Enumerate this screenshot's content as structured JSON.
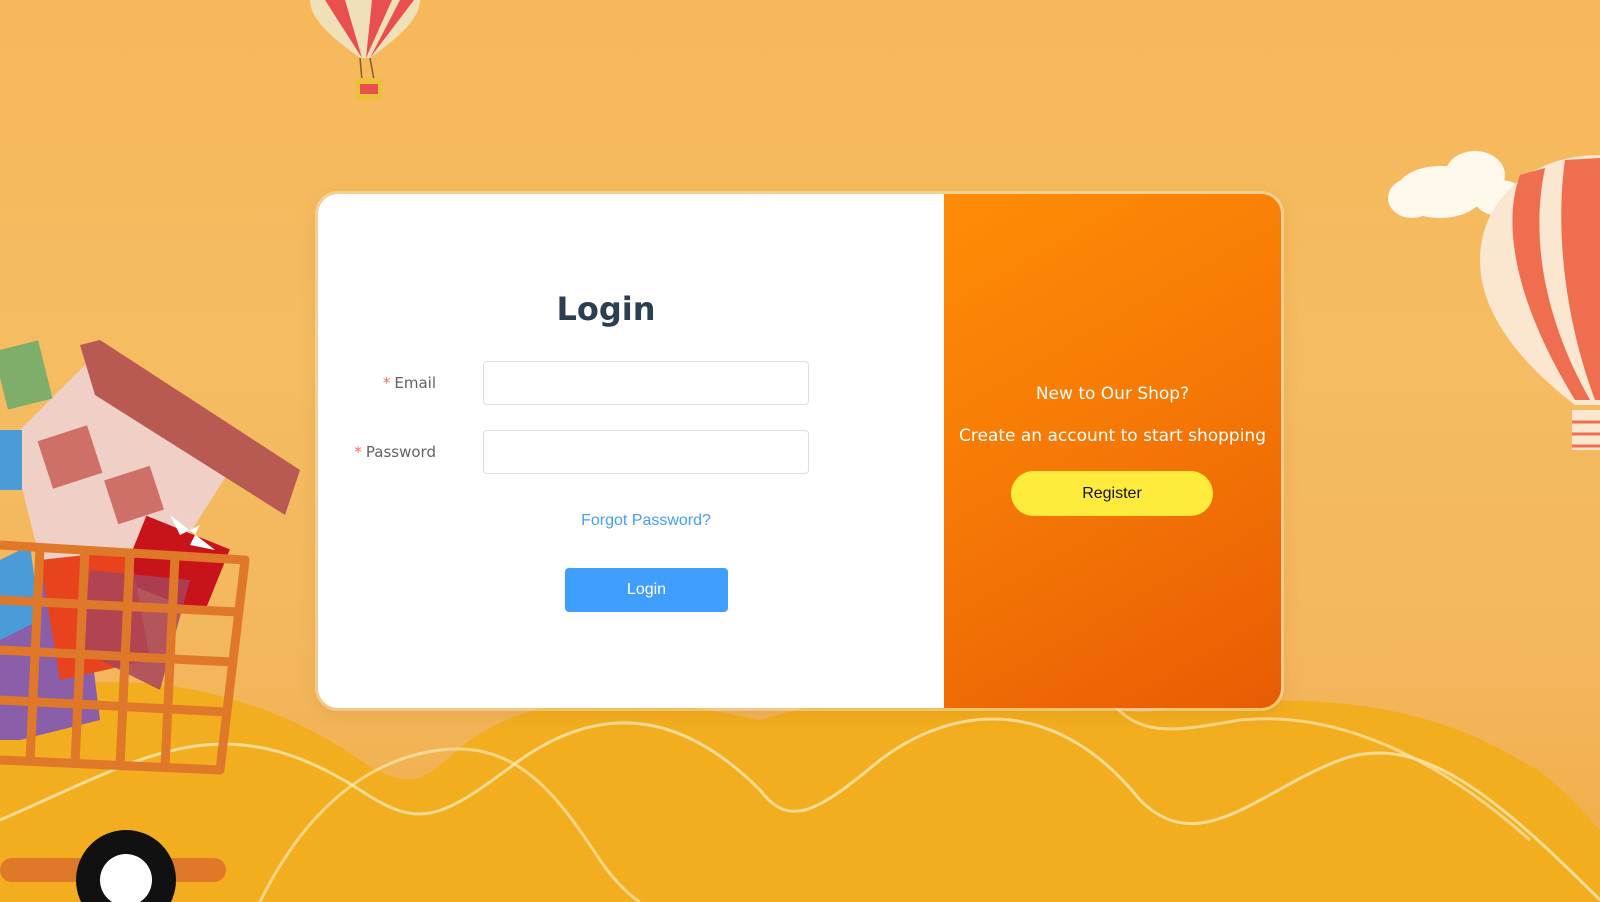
{
  "colors": {
    "accent": "#409eff",
    "promo_start": "#ff8c05",
    "promo_end": "#e85c04",
    "register_bg": "#ffeb3b",
    "required": "#f56c6c",
    "title": "#2c3e50"
  },
  "login_form": {
    "title": "Login",
    "email": {
      "required_mark": "*",
      "label": "Email",
      "value": "",
      "placeholder": ""
    },
    "password": {
      "required_mark": "*",
      "label": "Password",
      "value": "",
      "placeholder": ""
    },
    "forgot_password": "Forgot Password?",
    "submit_label": "Login"
  },
  "promo": {
    "title": "New to Our Shop?",
    "subtitle": "Create an account to start shopping",
    "register_label": "Register"
  },
  "decorations": {
    "icons": [
      "hot-air-balloon-icon",
      "cloud-icon",
      "shopping-cart-icon",
      "house-icon",
      "gift-box-icon",
      "hills-illustration"
    ]
  }
}
